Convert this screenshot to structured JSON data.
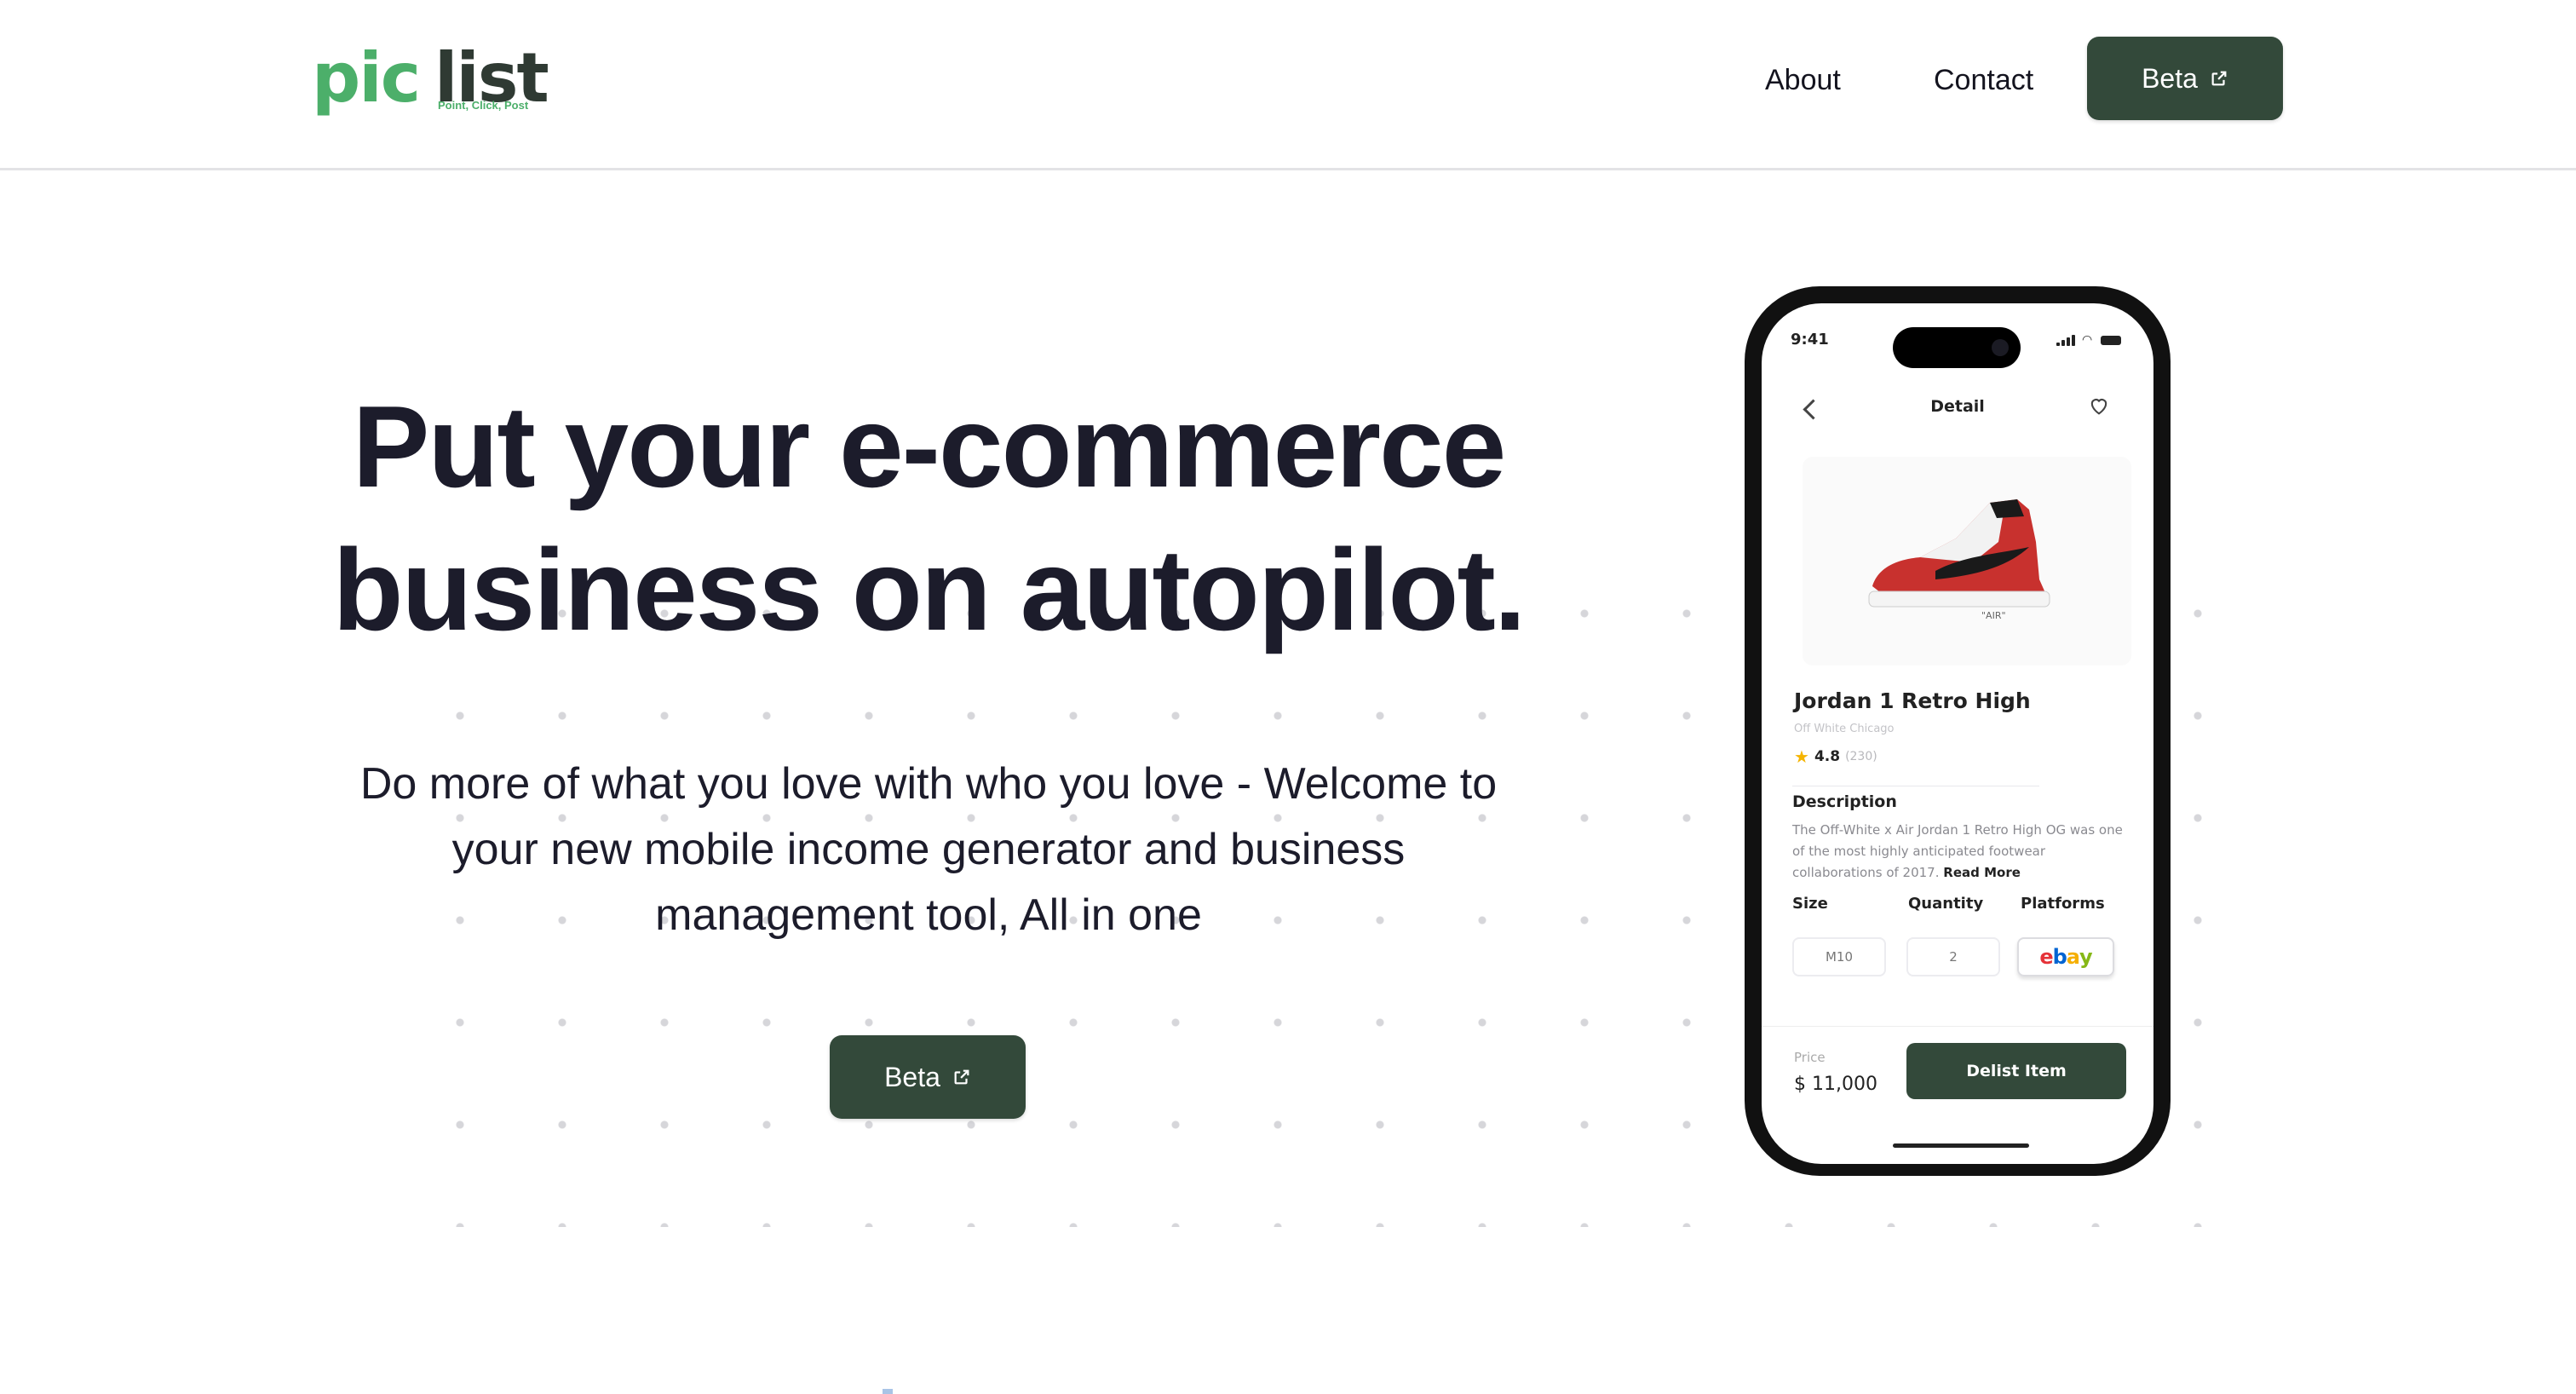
{
  "header": {
    "logo": {
      "word_pic": "pic",
      "word_list": "list",
      "tagline": "Point, Click, Post"
    },
    "nav": {
      "about": "About",
      "contact": "Contact",
      "beta": "Beta"
    }
  },
  "hero": {
    "title_line1": "Put your e-commerce",
    "title_line2": "business on autopilot.",
    "subtitle": "Do more of what you love with who you love - Welcome to your new mobile income generator and business management tool, All in one",
    "cta": "Beta"
  },
  "phone": {
    "status_time": "9:41",
    "screen_title": "Detail",
    "product_name": "Jordan 1 Retro High",
    "brand": "Off White Chicago",
    "rating": "4.8",
    "rating_count": "(230)",
    "description_heading": "Description",
    "description": "The Off-White x Air Jordan 1 Retro High OG was one of the most highly anticipated footwear collaborations of 2017.",
    "read_more": "Read More",
    "size_label": "Size",
    "quantity_label": "Quantity",
    "platforms_label": "Platforms",
    "size_value": "M10",
    "quantity_value": "2",
    "platform_logo": "ebay",
    "price_label": "Price",
    "price_value": "$ 11,000",
    "delist_button": "Delist Item"
  },
  "colors": {
    "brand_dark_green": "#33493a",
    "logo_green": "#4caf6a",
    "text_dark": "#1c1c2b"
  },
  "icons": [
    "external-link-icon",
    "back-chevron-icon",
    "heart-icon",
    "star-icon"
  ]
}
